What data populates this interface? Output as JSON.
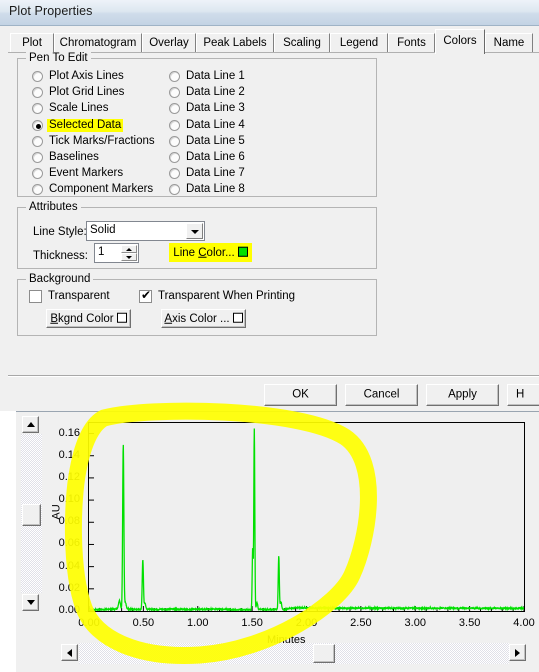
{
  "dialog": {
    "title": "Plot Properties",
    "tabs": [
      {
        "label": "Plot",
        "selected": false
      },
      {
        "label": "Chromatogram",
        "selected": false
      },
      {
        "label": "Overlay",
        "selected": false
      },
      {
        "label": "Peak Labels",
        "selected": false
      },
      {
        "label": "Scaling",
        "selected": false
      },
      {
        "label": "Legend",
        "selected": false
      },
      {
        "label": "Fonts",
        "selected": false
      },
      {
        "label": "Colors",
        "selected": true
      },
      {
        "label": "Name",
        "selected": false
      }
    ],
    "pen_to_edit": {
      "legend": "Pen To Edit",
      "left_options": [
        {
          "label": "Plot Axis Lines",
          "checked": false,
          "highlighted": false
        },
        {
          "label": "Plot Grid Lines",
          "checked": false,
          "highlighted": false
        },
        {
          "label": "Scale Lines",
          "checked": false,
          "highlighted": false
        },
        {
          "label": "Selected Data",
          "checked": true,
          "highlighted": true
        },
        {
          "label": "Tick Marks/Fractions",
          "checked": false,
          "highlighted": false
        },
        {
          "label": "Baselines",
          "checked": false,
          "highlighted": false
        },
        {
          "label": "Event Markers",
          "checked": false,
          "highlighted": false
        },
        {
          "label": "Component Markers",
          "checked": false,
          "highlighted": false
        }
      ],
      "right_options": [
        {
          "label": "Data Line 1",
          "checked": false
        },
        {
          "label": "Data Line 2",
          "checked": false
        },
        {
          "label": "Data Line 3",
          "checked": false
        },
        {
          "label": "Data Line 4",
          "checked": false
        },
        {
          "label": "Data Line 5",
          "checked": false
        },
        {
          "label": "Data Line 6",
          "checked": false
        },
        {
          "label": "Data Line 7",
          "checked": false
        },
        {
          "label": "Data Line 8",
          "checked": false
        }
      ]
    },
    "attributes": {
      "legend": "Attributes",
      "line_style_label": "Line Style:",
      "line_style_value": "Solid",
      "line_style_options": [
        "Solid"
      ],
      "thickness_label": "Thickness:",
      "thickness_value": "1",
      "line_color_button": "Line Color...",
      "line_color_swatch": "#00e000",
      "line_color_highlighted": true
    },
    "background": {
      "legend": "Background",
      "transparent_label": "Transparent",
      "transparent_checked": false,
      "transparent_printing_label": "Transparent When Printing",
      "transparent_printing_checked": true,
      "bkgnd_color_button": "Bkgnd Color",
      "bkgnd_color_swatch": "#ffffff",
      "axis_color_button": "Axis Color ...",
      "axis_color_swatch": "#ffffff"
    },
    "buttons": [
      {
        "label": "OK"
      },
      {
        "label": "Cancel"
      },
      {
        "label": "Apply"
      },
      {
        "label": "H"
      }
    ]
  },
  "annotation": {
    "highlight_color": "#ffff00",
    "oval_note": "hand-drawn yellow oval around chromatogram plot area"
  },
  "plot": {
    "scroll_up_icon": "triangle-up-icon",
    "scroll_down_icon": "triangle-down-icon",
    "scroll_left_icon": "triangle-left-icon",
    "scroll_right_icon": "triangle-right-icon"
  },
  "chart_data": {
    "type": "line",
    "title": "",
    "xlabel": "Minutes",
    "ylabel": "AU",
    "xlim": [
      0.0,
      4.0
    ],
    "ylim": [
      0.0,
      0.1695
    ],
    "grid": false,
    "legend": null,
    "line_color": "#00e000",
    "xticks": [
      "0.00",
      "0.50",
      "1.00",
      "1.50",
      "2.00",
      "2.50",
      "3.00",
      "3.50",
      "4.00"
    ],
    "xtick_values": [
      0.0,
      0.5,
      1.0,
      1.5,
      2.0,
      2.5,
      3.0,
      3.5,
      4.0
    ],
    "yticks": [
      "0.00",
      "0.02",
      "0.04",
      "0.06",
      "0.08",
      "0.10",
      "0.12",
      "0.14",
      "0.16"
    ],
    "ytick_values": [
      0.0,
      0.02,
      0.04,
      0.06,
      0.08,
      0.1,
      0.12,
      0.14,
      0.16
    ],
    "peaks": [
      {
        "time": 0.28,
        "height": 0.0075,
        "width": 0.018
      },
      {
        "time": 0.315,
        "height": 0.149,
        "width": 0.012
      },
      {
        "time": 0.335,
        "height": 0.006,
        "width": 0.016
      },
      {
        "time": 0.495,
        "height": 0.045,
        "width": 0.012
      },
      {
        "time": 0.515,
        "height": 0.006,
        "width": 0.014
      },
      {
        "time": 1.505,
        "height": 0.055,
        "width": 0.01
      },
      {
        "time": 1.52,
        "height": 0.163,
        "width": 0.01
      },
      {
        "time": 1.545,
        "height": 0.006,
        "width": 0.014
      },
      {
        "time": 1.745,
        "height": 0.048,
        "width": 0.011
      },
      {
        "time": 1.765,
        "height": 0.007,
        "width": 0.014
      }
    ],
    "baseline": 0.0015,
    "series": [
      {
        "name": "Selected Data",
        "x": [
          0.0,
          0.1,
          0.18,
          0.25,
          0.6,
          0.8,
          1.0,
          1.2,
          1.3,
          1.45,
          1.6,
          1.8,
          1.9,
          2.0,
          2.1,
          2.3,
          2.6,
          3.0,
          3.4,
          4.0
        ],
        "y": [
          0.0012,
          0.0012,
          0.0016,
          0.0018,
          0.0014,
          0.0016,
          0.0015,
          0.0018,
          0.0013,
          0.0012,
          0.0013,
          0.0014,
          0.003,
          0.0026,
          0.0028,
          0.0026,
          0.0026,
          0.0025,
          0.0025,
          0.0024
        ]
      }
    ]
  }
}
